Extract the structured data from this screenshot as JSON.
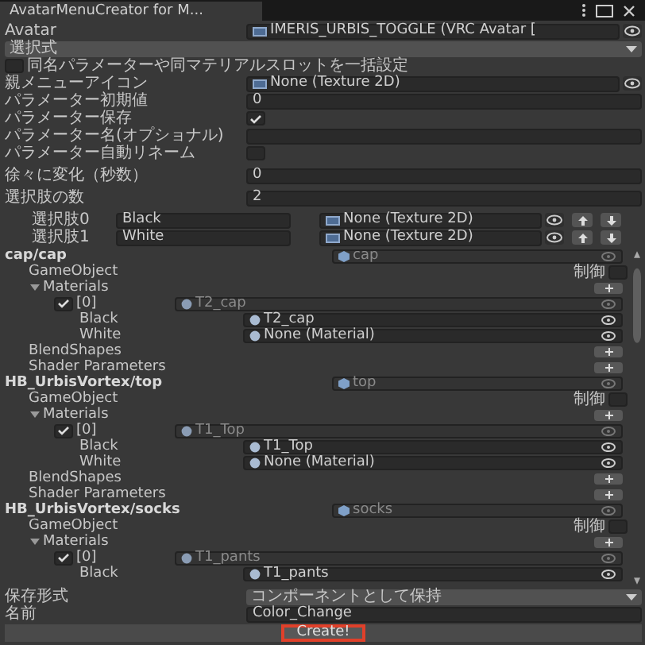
{
  "window": {
    "title": "AvatarMenuCreator for M..."
  },
  "groups": [
    [
      {
        "kind": "object",
        "label": "Avatar",
        "value": "IMERIS_URBIS_TOGGLE (VRC Avatar ["
      },
      {
        "kind": "dropdown",
        "value": "選択式"
      },
      {
        "kind": "toggle",
        "label": "同名パラメーターや同マテリアルスロットを一括設定",
        "checked": false
      },
      {
        "kind": "object",
        "label": "親メニューアイコン",
        "value": "None (Texture 2D)"
      },
      {
        "kind": "text",
        "label": "パラメーター初期値",
        "value": "0"
      },
      {
        "kind": "check",
        "label": "パラメーター保存",
        "checked": true
      },
      {
        "kind": "text",
        "label": "パラメーター名(オプショナル)"
      },
      {
        "kind": "check",
        "label": "パラメーター自動リネーム",
        "checked": false
      }
    ],
    [
      {
        "kind": "text",
        "label": "徐々に変化（秒数）",
        "value": "0"
      }
    ],
    [
      {
        "kind": "text",
        "label": "選択肢の数",
        "value": "2"
      }
    ]
  ],
  "options": [
    {
      "label": "選択肢0",
      "name": "Black",
      "icon": "None (Texture 2D)"
    },
    {
      "label": "選択肢1",
      "name": "White",
      "icon": "None (Texture 2D)"
    }
  ],
  "objects": [
    {
      "path": "cap/cap",
      "object": "cap",
      "gameobject": "GameObject",
      "control": "制御",
      "control_checked": false,
      "materials": "Materials",
      "expanded": true,
      "slots": [
        {
          "index": "[0]",
          "checked": true,
          "material": "T2_cap",
          "choices": [
            {
              "name": "Black",
              "value": "T2_cap"
            },
            {
              "name": "White",
              "value": "None (Material)"
            }
          ]
        }
      ],
      "blendshapes": "BlendShapes",
      "shader": "Shader Parameters"
    },
    {
      "path": "HB_UrbisVortex/top",
      "object": "top",
      "gameobject": "GameObject",
      "control": "制御",
      "control_checked": false,
      "materials": "Materials",
      "expanded": true,
      "slots": [
        {
          "index": "[0]",
          "checked": true,
          "material": "T1_Top",
          "choices": [
            {
              "name": "Black",
              "value": "T1_Top"
            },
            {
              "name": "White",
              "value": "None (Material)"
            }
          ]
        }
      ],
      "blendshapes": "BlendShapes",
      "shader": "Shader Parameters"
    },
    {
      "path": "HB_UrbisVortex/socks",
      "object": "socks",
      "gameobject": "GameObject",
      "control": "制御",
      "control_checked": false,
      "materials": "Materials",
      "expanded": true,
      "slots": [
        {
          "index": "[0]",
          "checked": true,
          "material": "T1_pants",
          "choices": [
            {
              "name": "Black",
              "value": "T1_pants"
            }
          ]
        }
      ]
    }
  ],
  "footer": {
    "format_label": "保存形式",
    "format": "コンポーネントとして保持",
    "name_label": "名前",
    "name": "Color_Change",
    "button": "Create!",
    "button_highlighted": true
  }
}
